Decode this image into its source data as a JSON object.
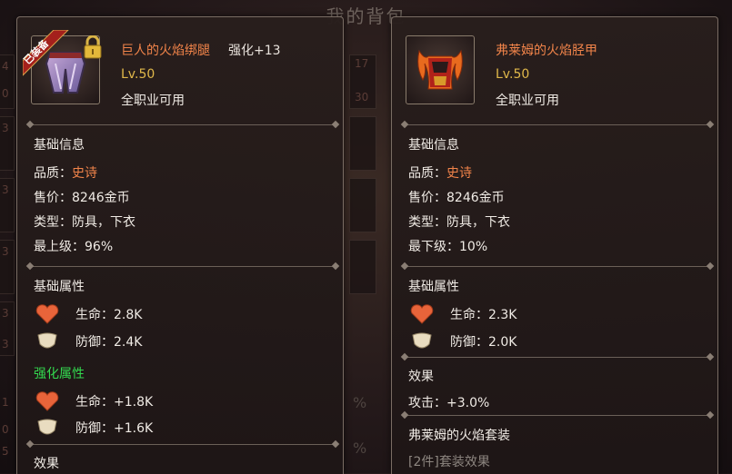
{
  "background": {
    "title": "我的背包",
    "left_numbers": [
      "4",
      "0",
      "3",
      "3",
      "3",
      "3",
      "3",
      "1",
      "0",
      "5"
    ],
    "right_numbers": [
      "17",
      "30"
    ],
    "percents": [
      "%",
      "%"
    ]
  },
  "left": {
    "equipped_badge": "已装备",
    "name": "巨人的火焰绑腿",
    "enhance": "强化+13",
    "level": "Lv.50",
    "usable": "全职业可用",
    "basic_title": "基础信息",
    "quality_label": "品质：",
    "quality_value": "史诗",
    "price": "售价：8246金币",
    "type": "类型：防具，下衣",
    "tier": "最上级：96%",
    "attr_title": "基础属性",
    "hp": "生命：2.8K",
    "def": "防御：2.4K",
    "enh_title": "强化属性",
    "enh_hp": "生命：+1.8K",
    "enh_def": "防御：+1.6K",
    "effect_title": "效果"
  },
  "right": {
    "name": "弗莱姆的火焰胫甲",
    "level": "Lv.50",
    "usable": "全职业可用",
    "basic_title": "基础信息",
    "quality_label": "品质：",
    "quality_value": "史诗",
    "price": "售价：8246金币",
    "type": "类型：防具，下衣",
    "tier": "最下级：10%",
    "attr_title": "基础属性",
    "hp": "生命：2.3K",
    "def": "防御：2.0K",
    "effect_title": "效果",
    "attack": "攻击：+3.0%",
    "set_name": "弗莱姆的火焰套装",
    "set_effect": "[2件]套装效果"
  },
  "colors": {
    "item_name": "#f1844a",
    "level": "#e0b84a",
    "quality_epic": "#f1844a",
    "enhance_title": "#33d94f",
    "heart": "#e8643a",
    "shield": "#e9dcc0"
  }
}
